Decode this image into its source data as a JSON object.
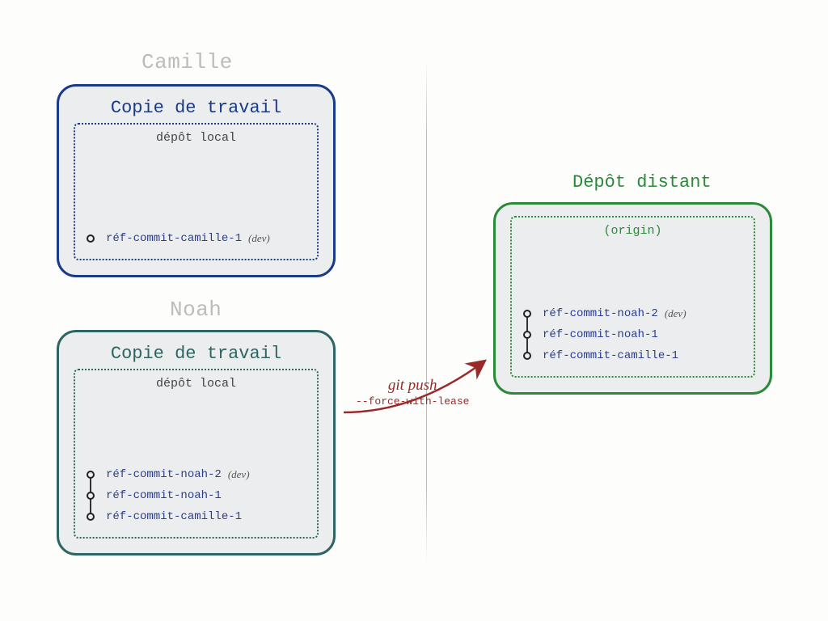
{
  "labels": {
    "camille": "Camille",
    "noah": "Noah",
    "working_copy": "Copie de travail",
    "local_repo": "dépôt local",
    "remote_repo": "Dépôt distant",
    "origin": "(origin)"
  },
  "camille": {
    "commits": [
      {
        "ref": "réf-commit-camille-1",
        "branch": "(dev)"
      }
    ]
  },
  "noah": {
    "commits": [
      {
        "ref": "réf-commit-noah-2",
        "branch": "(dev)"
      },
      {
        "ref": "réf-commit-noah-1",
        "branch": ""
      },
      {
        "ref": "réf-commit-camille-1",
        "branch": ""
      }
    ]
  },
  "remote": {
    "commits": [
      {
        "ref": "réf-commit-noah-2",
        "branch": "(dev)"
      },
      {
        "ref": "réf-commit-noah-1",
        "branch": ""
      },
      {
        "ref": "réf-commit-camille-1",
        "branch": ""
      }
    ]
  },
  "command": {
    "text": "git push",
    "flag": "--force-with-lease"
  },
  "colors": {
    "camille": "#1a3a8a",
    "noah": "#2d6660",
    "remote": "#2a8a3a",
    "command": "#9a2a2a"
  }
}
